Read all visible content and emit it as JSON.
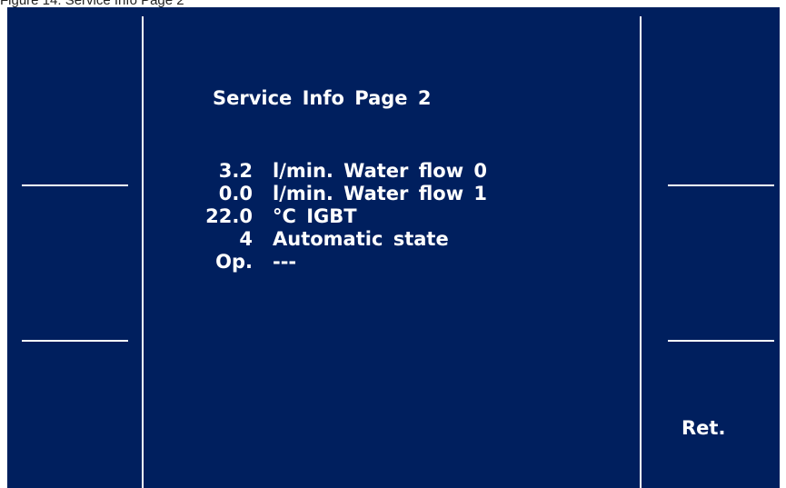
{
  "caption": "Figure 14: Service Info Page 2",
  "screen": {
    "title": "Service Info Page 2",
    "rows": [
      {
        "value": "3.2",
        "label": "l/min. Water flow 0"
      },
      {
        "value": "0.0",
        "label": "l/min. Water flow 1"
      },
      {
        "value": "22.0",
        "label": "°C IGBT"
      },
      {
        "value": "4",
        "label": "Automatic state"
      },
      {
        "value": "Op.",
        "label": "---"
      }
    ],
    "softkeys": {
      "ret_label": "Ret."
    },
    "colors": {
      "background": "#001f5e",
      "foreground": "#ffffff"
    }
  }
}
